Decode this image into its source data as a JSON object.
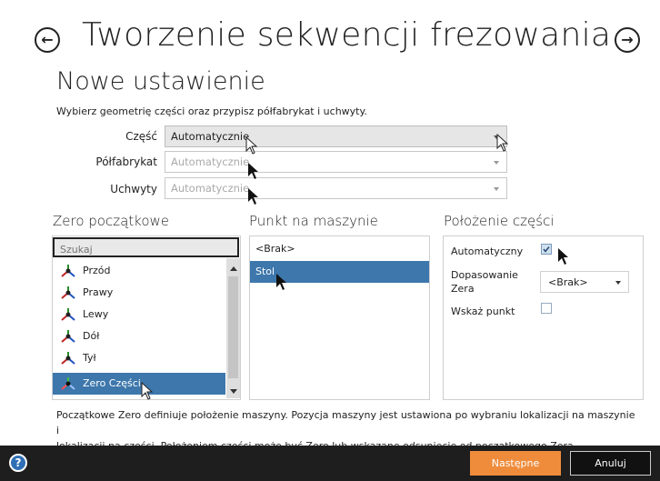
{
  "header": {
    "title": "Tworzenie sekwencji frezowania",
    "subtitle": "Nowe ustawienie",
    "instruction": "Wybierz geometrię części oraz przypisz półfabrykat i uchwyty.",
    "back_icon": "arrow-left-circle-icon",
    "forward_icon": "arrow-right-circle-icon"
  },
  "fields": [
    {
      "label": "Część",
      "value": "Automatycznie",
      "state": "active"
    },
    {
      "label": "Półfabrykat",
      "value": "Automatycznie",
      "state": "disabled"
    },
    {
      "label": "Uchwyty",
      "value": "Automatycznie",
      "state": "disabled"
    }
  ],
  "zero": {
    "heading": "Zero początkowe",
    "search_placeholder": "Szukaj",
    "items": [
      {
        "label": "Przód",
        "selected": false
      },
      {
        "label": "Prawy",
        "selected": false
      },
      {
        "label": "Lewy",
        "selected": false
      },
      {
        "label": "Dół",
        "selected": false
      },
      {
        "label": "Tył",
        "selected": false
      },
      {
        "label": "Zero Części",
        "selected": true
      }
    ]
  },
  "machine": {
    "heading": "Punkt na maszynie",
    "items": [
      {
        "label": "<Brak>",
        "selected": false
      },
      {
        "label": "Stol",
        "selected": true
      }
    ]
  },
  "position": {
    "heading": "Położenie części",
    "auto_label": "Automatyczny",
    "auto_checked": true,
    "match_label_1": "Dopasowanie",
    "match_label_2": "Zera",
    "match_value": "<Brak>",
    "show_label": "Wskaż punkt",
    "show_checked": false
  },
  "description_1": "Początkowe Zero definiuje położenie maszyny. Pozycja maszyny jest ustawiona po wybraniu lokalizacji na maszynie i",
  "description_2": "lokalizacji na części. Położeniem części może być Zero lub wskazane odsunięcie  od początkowego Zera.",
  "footer": {
    "help_label": "?",
    "next_label": "Następne",
    "cancel_label": "Anuluj"
  },
  "colors": {
    "selection": "#3d77ac",
    "primary_button": "#ef8c3c",
    "footer": "#1e1e1e"
  }
}
